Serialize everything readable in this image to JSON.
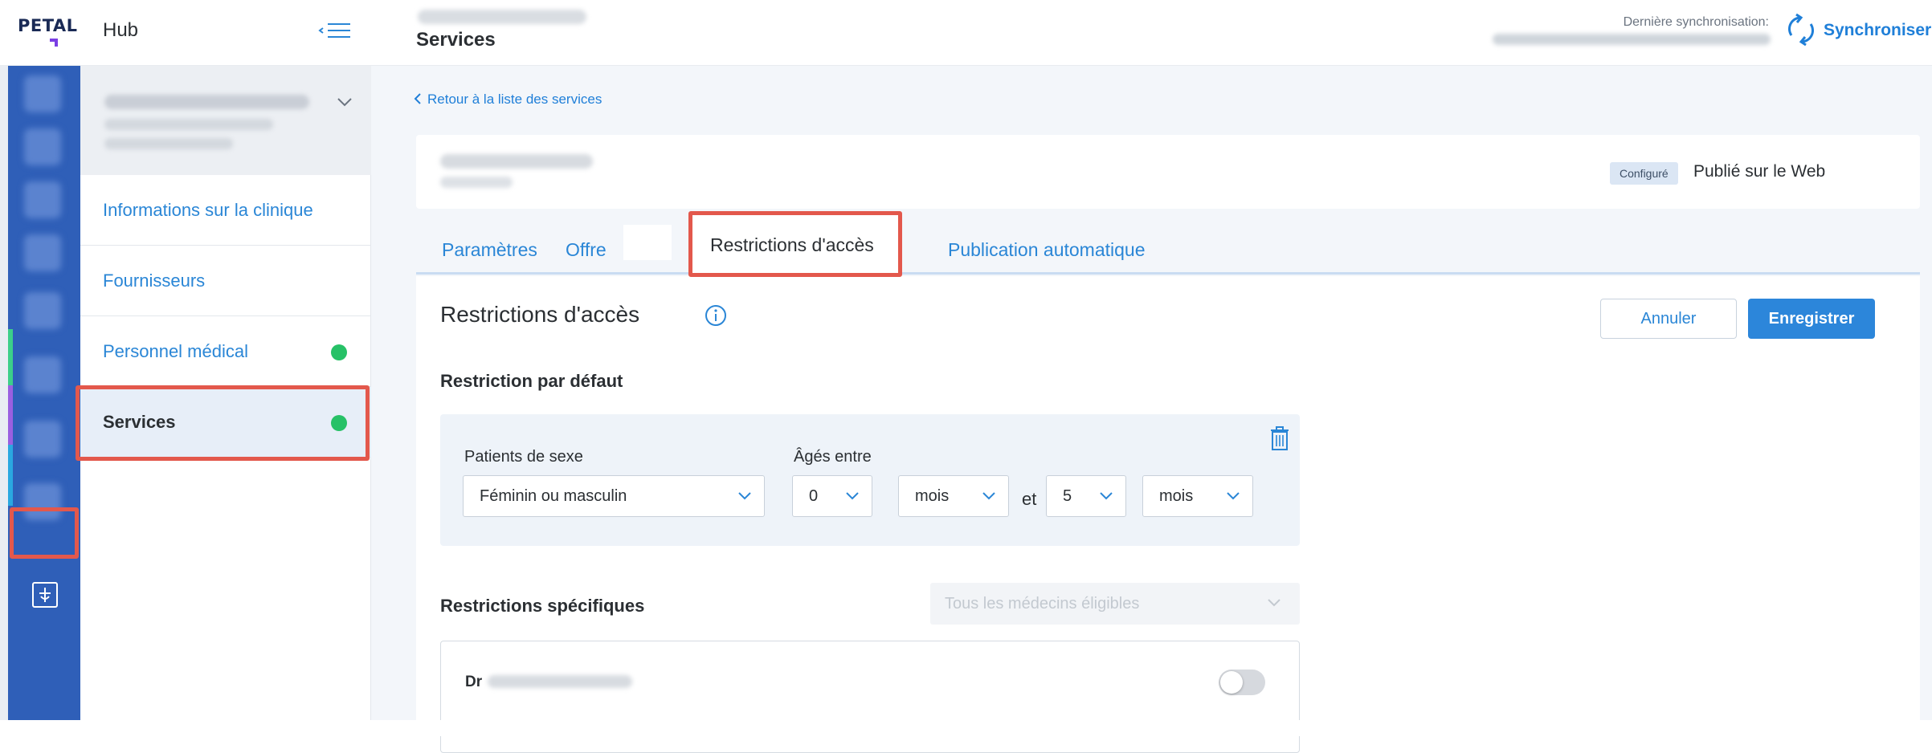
{
  "header": {
    "logo_text": "PETAL",
    "hub_title": "Hub",
    "page_title": "Services",
    "sync_label": "Dernière synchronisation:",
    "sync_link": "Synchroniser"
  },
  "sidebar": {
    "items": [
      {
        "label": "Informations sur la clinique",
        "dot": false,
        "active": false
      },
      {
        "label": "Fournisseurs",
        "dot": false,
        "active": false
      },
      {
        "label": "Personnel médical",
        "dot": true,
        "active": false
      },
      {
        "label": "Services",
        "dot": true,
        "active": true
      }
    ]
  },
  "main": {
    "back_link": "Retour à la liste des services",
    "status_badge": "Configuré",
    "published_label": "Publié sur le Web",
    "tabs": [
      {
        "label": "Paramètres"
      },
      {
        "label": "Offre"
      },
      {
        "label": "Restrictions d'accès",
        "active": true
      },
      {
        "label": "Publication automatique"
      }
    ],
    "section_title": "Restrictions d'accès",
    "cancel_label": "Annuler",
    "save_label": "Enregistrer",
    "default_restriction": {
      "title": "Restriction par défaut",
      "sex_label": "Patients de sexe",
      "sex_value": "Féminin ou masculin",
      "age_label": "Âgés entre",
      "age_min": "0",
      "age_min_unit": "mois",
      "between_word": "et",
      "age_max": "5",
      "age_max_unit": "mois"
    },
    "specific_restrictions": {
      "title": "Restrictions spécifiques",
      "doctor_select": "Tous les médecins éligibles",
      "doctor_prefix": "Dr"
    }
  },
  "colors": {
    "accent": "#2c86da",
    "highlight": "#e3584c",
    "status_dot": "#27c167",
    "rail": "#2f5fb8"
  }
}
